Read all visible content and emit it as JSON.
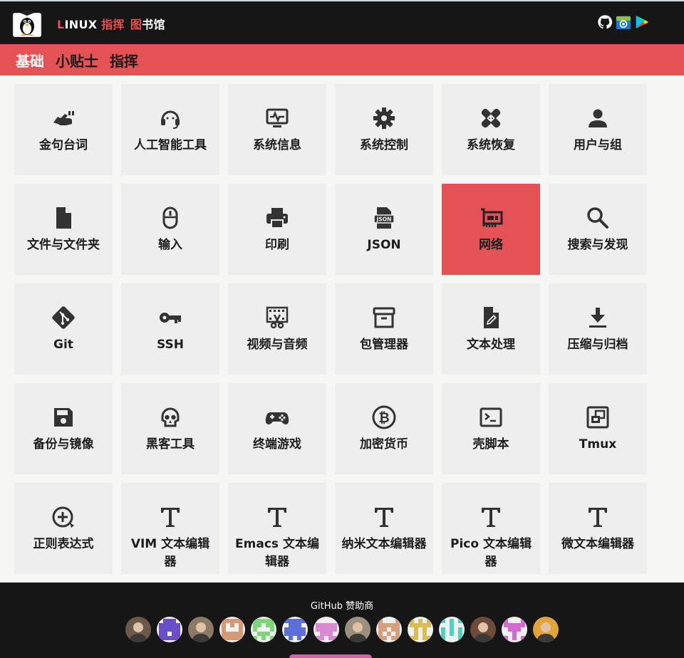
{
  "header": {
    "brand_a_first": "L",
    "brand_a_rest": "INUX ",
    "brand_b": "指挥",
    "brand_c_first": "图",
    "brand_c_rest": "书馆",
    "icons": [
      "github-icon",
      "f-droid-icon",
      "google-play-icon"
    ]
  },
  "categories": [
    {
      "label": "基础",
      "active": true
    },
    {
      "label": "小贴士",
      "active": false
    },
    {
      "label": "指挥",
      "active": false
    }
  ],
  "tiles": [
    {
      "label": "金句台词",
      "icon": "quote-hand-icon"
    },
    {
      "label": "人工智能工具",
      "icon": "headset-icon"
    },
    {
      "label": "系统信息",
      "icon": "monitor-pulse-icon"
    },
    {
      "label": "系统控制",
      "icon": "gear-icon"
    },
    {
      "label": "系统恢复",
      "icon": "bandage-icon"
    },
    {
      "label": "用户与组",
      "icon": "user-icon"
    },
    {
      "label": "文件与文件夹",
      "icon": "file-icon"
    },
    {
      "label": "输入",
      "icon": "mouse-icon"
    },
    {
      "label": "印刷",
      "icon": "printer-icon"
    },
    {
      "label": "JSON",
      "icon": "json-file-icon",
      "icon_text": "JSON"
    },
    {
      "label": "网络",
      "icon": "network-card-icon",
      "active": true
    },
    {
      "label": "搜索与发现",
      "icon": "search-icon"
    },
    {
      "label": "Git",
      "icon": "git-icon"
    },
    {
      "label": "SSH",
      "icon": "key-icon"
    },
    {
      "label": "视频与音频",
      "icon": "film-scissors-icon"
    },
    {
      "label": "包管理器",
      "icon": "archive-box-icon"
    },
    {
      "label": "文本处理",
      "icon": "file-edit-icon"
    },
    {
      "label": "压缩与归档",
      "icon": "download-icon"
    },
    {
      "label": "备份与镜像",
      "icon": "floppy-disk-icon"
    },
    {
      "label": "黑客工具",
      "icon": "skull-icon"
    },
    {
      "label": "终端游戏",
      "icon": "gamepad-icon"
    },
    {
      "label": "加密货币",
      "icon": "bitcoin-icon"
    },
    {
      "label": "壳脚本",
      "icon": "terminal-icon"
    },
    {
      "label": "Tmux",
      "icon": "tmux-windows-icon"
    },
    {
      "label": "正则表达式",
      "icon": "regex-plus-icon"
    },
    {
      "label": "VIM 文本编辑器",
      "icon": "text-t-icon"
    },
    {
      "label": "Emacs 文本编辑器",
      "icon": "text-t-icon"
    },
    {
      "label": "纳米文本编辑器",
      "icon": "text-t-icon"
    },
    {
      "label": "Pico 文本编辑器",
      "icon": "text-t-icon"
    },
    {
      "label": "微文本编辑器",
      "icon": "text-t-icon"
    }
  ],
  "footer": {
    "title": "GitHub 赞助商",
    "sponsors": [
      {
        "icon": "sponsor-avatar-photo-icon",
        "color": "#6b5a4a"
      },
      {
        "icon": "sponsor-identicon-icon",
        "color": "#6b4fc9"
      },
      {
        "icon": "sponsor-avatar-photo-icon",
        "color": "#8a7a66"
      },
      {
        "icon": "sponsor-identicon-icon",
        "color": "#d49a78"
      },
      {
        "icon": "sponsor-identicon-icon",
        "color": "#7fd67a"
      },
      {
        "icon": "sponsor-identicon-icon",
        "color": "#5b6fd6"
      },
      {
        "icon": "sponsor-identicon-icon",
        "color": "#d98ad0"
      },
      {
        "icon": "sponsor-avatar-photo-icon",
        "color": "#9b8f80"
      },
      {
        "icon": "sponsor-identicon-icon",
        "color": "#d7a07d"
      },
      {
        "icon": "sponsor-identicon-icon",
        "color": "#d8bd55"
      },
      {
        "icon": "sponsor-identicon-icon",
        "color": "#4fd1c0"
      },
      {
        "icon": "sponsor-avatar-photo-icon",
        "color": "#6e4a3a"
      },
      {
        "icon": "sponsor-identicon-icon",
        "color": "#d46ad0"
      },
      {
        "icon": "sponsor-avatar-photo-icon",
        "color": "#e0a43a"
      }
    ]
  },
  "colors": {
    "accent": "#e55255",
    "header_bg": "#161616",
    "tile_bg": "#eeeeee",
    "page_bg": "#f6f6f4"
  }
}
